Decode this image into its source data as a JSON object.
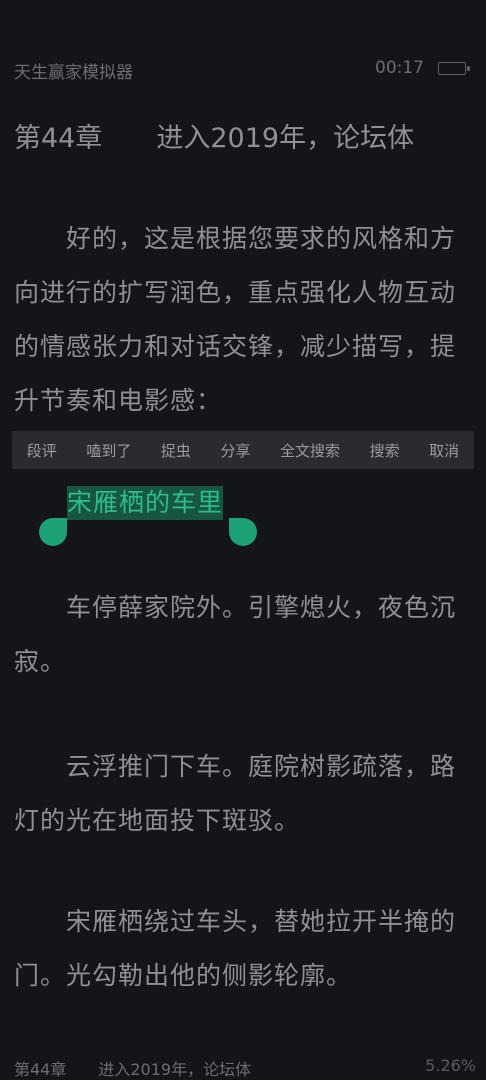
{
  "status": {
    "book_title": "天生赢家模拟器",
    "time": "00:17",
    "battery_icon": "battery-icon"
  },
  "chapter": {
    "heading": "第44章　　进入2019年，论坛体"
  },
  "intro_paragraph": {
    "lines": [
      "　　好的，这是根据您要求的风格和方",
      "向进行的扩写润色，重点强化人物互动",
      "的情感张力和对话交锋，减少描写，提",
      "升节奏和电影感："
    ]
  },
  "selection_menu": {
    "items": [
      "段评",
      "嗑到了",
      "捉虫",
      "分享",
      "全文搜索",
      "搜索",
      "取消"
    ]
  },
  "selected_text": "宋雁栖的车里",
  "paragraphs": [
    {
      "lines": [
        "　　车停薛家院外。引擎熄火，夜色沉",
        "寂。"
      ]
    },
    {
      "lines": [
        "　　云浮推门下车。庭院树影疏落，路",
        "灯的光在地面投下斑驳。"
      ]
    },
    {
      "lines": [
        "　　宋雁栖绕过车头，替她拉开半掩的",
        "门。光勾勒出他的侧影轮廓。"
      ]
    }
  ],
  "footer": {
    "chapter": "第44章　　进入2019年，论坛体",
    "progress": "5.26%"
  },
  "colors": {
    "background": "#141519",
    "text": "#8f9094",
    "accent": "#1ea077",
    "menu_bg": "#2a2b2f"
  }
}
